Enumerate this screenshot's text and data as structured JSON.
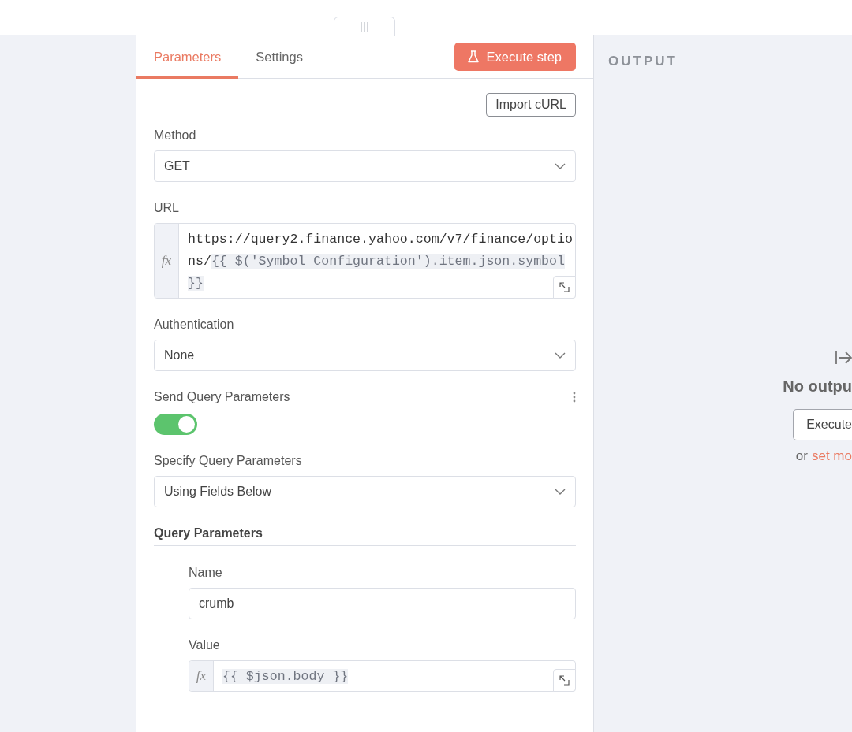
{
  "tabs": [
    {
      "label": "Parameters",
      "selected": true
    },
    {
      "label": "Settings",
      "selected": false
    }
  ],
  "execute_button": "Execute step",
  "import_button": "Import cURL",
  "fields": [
    {
      "kind": "select",
      "label": "Method",
      "value": "GET"
    },
    {
      "kind": "expression",
      "label": "URL",
      "gutter": "fx",
      "text": "https://query2.finance.yahoo.com/v7/finance/options/",
      "expression": "{{ $('Symbol Configuration').item.json.symbol }}"
    },
    {
      "kind": "select",
      "label": "Authentication",
      "value": "None"
    },
    {
      "kind": "toggle",
      "label": "Send Query Parameters",
      "on": true
    },
    {
      "kind": "select",
      "label": "Specify Query Parameters",
      "value": "Using Fields Below"
    },
    {
      "kind": "section",
      "label": "Query Parameters",
      "children": [
        {
          "kind": "text",
          "label": "Name",
          "value": "crumb"
        },
        {
          "kind": "expression",
          "label": "Value",
          "gutter": "fx",
          "expression": "{{ $json.body }}"
        }
      ]
    }
  ],
  "output": {
    "title": "OUTPUT",
    "message": "No outpu",
    "button": "Execute",
    "hint": "or",
    "link": "set mo"
  }
}
